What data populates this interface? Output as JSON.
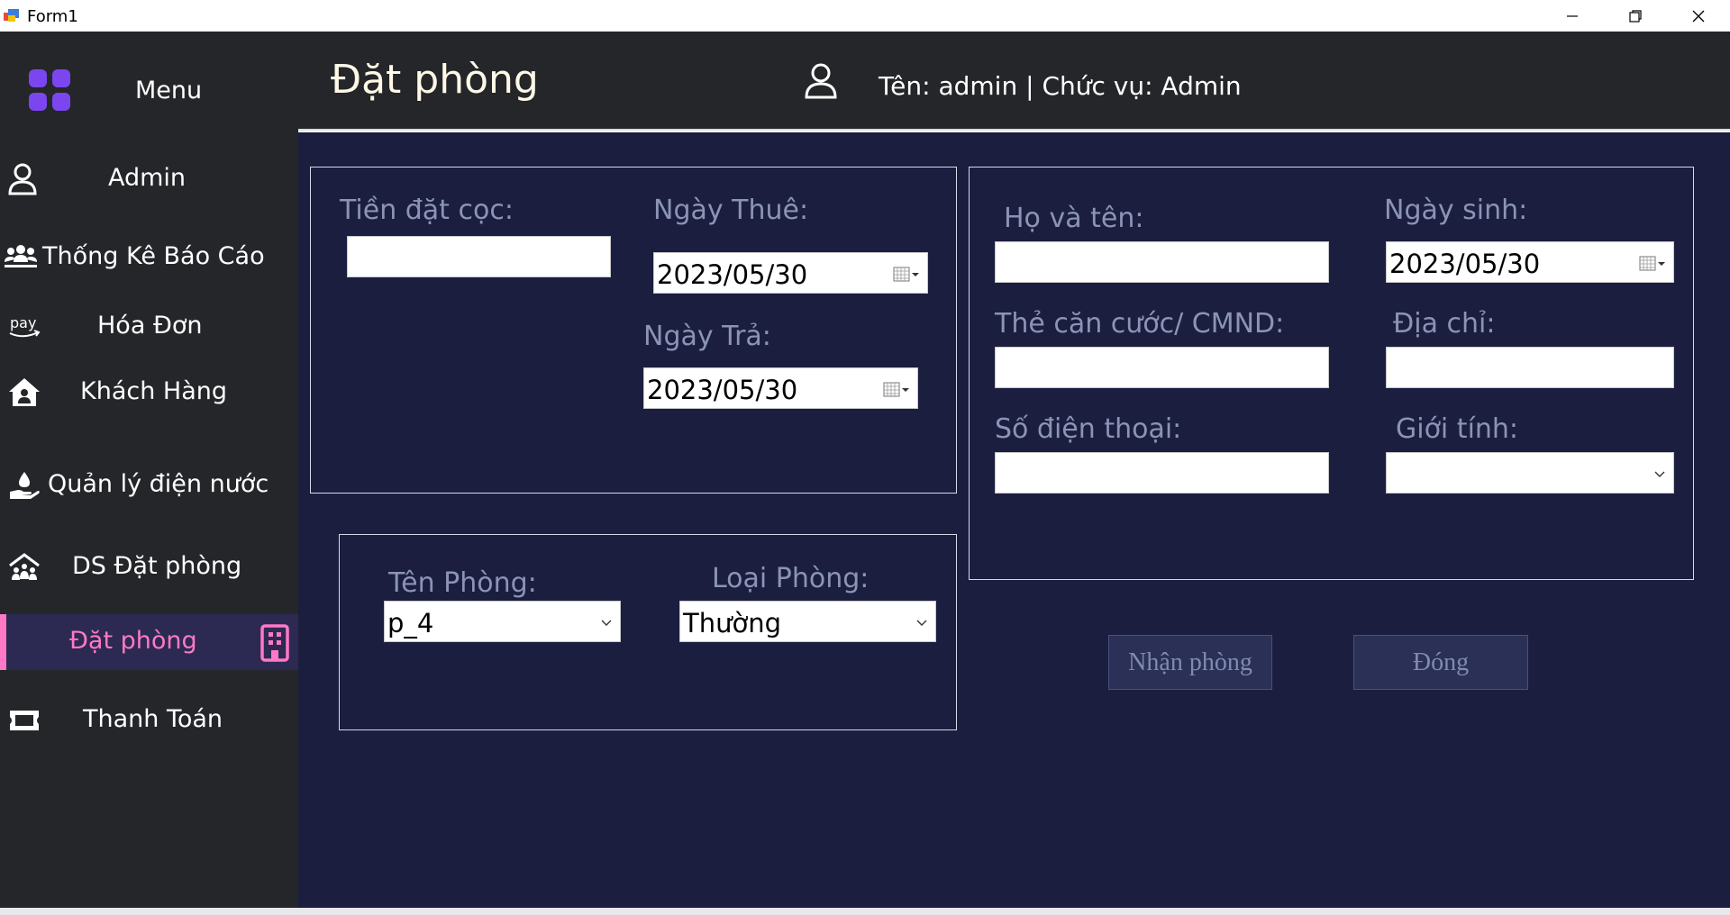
{
  "window": {
    "title": "Form1"
  },
  "sidebar": {
    "menu_label": "Menu",
    "items": [
      {
        "label": "Admin",
        "icon": "user-icon"
      },
      {
        "label": "Thống Kê Báo Cáo",
        "icon": "group-icon"
      },
      {
        "label": "Hóa Đơn",
        "icon": "amazon-pay-icon"
      },
      {
        "label": "Khách Hàng",
        "icon": "house-user-icon"
      },
      {
        "label": "Quản lý điện nước",
        "icon": "hand-water-icon"
      },
      {
        "label": "DS Đặt phòng",
        "icon": "house-people-icon"
      },
      {
        "label": "Đặt phòng",
        "icon": "building-icon",
        "active": true
      },
      {
        "label": "Thanh Toán",
        "icon": "ticket-icon"
      }
    ]
  },
  "header": {
    "title": "Đặt phòng",
    "user_info": "Tên: admin | Chức vụ: Admin"
  },
  "booking": {
    "deposit_label": "Tiền đặt cọc:",
    "deposit_value": "",
    "rent_date_label": "Ngày Thuê:",
    "rent_date_value": "2023/05/30",
    "return_date_label": "Ngày Trả:",
    "return_date_value": "2023/05/30"
  },
  "room": {
    "name_label": "Tên Phòng:",
    "name_value": "p_4",
    "type_label": "Loại Phòng:",
    "type_value": "Thường"
  },
  "customer": {
    "fullname_label": "Họ và tên:",
    "fullname_value": "",
    "birthdate_label": "Ngày sinh:",
    "birthdate_value": "2023/05/30",
    "id_label": "Thẻ căn cước/ CMND:",
    "id_value": "",
    "address_label": "Địa chỉ:",
    "address_value": "",
    "phone_label": "Số điện thoại:",
    "phone_value": "",
    "gender_label": "Giới tính:",
    "gender_value": ""
  },
  "actions": {
    "confirm_label": "Nhận phòng",
    "close_label": "Đóng"
  },
  "colors": {
    "sidebar_bg": "#242629",
    "main_bg": "#1b1e3f",
    "accent": "#ff79c6",
    "label": "#8b94b6",
    "logo": "#7b46f0"
  }
}
